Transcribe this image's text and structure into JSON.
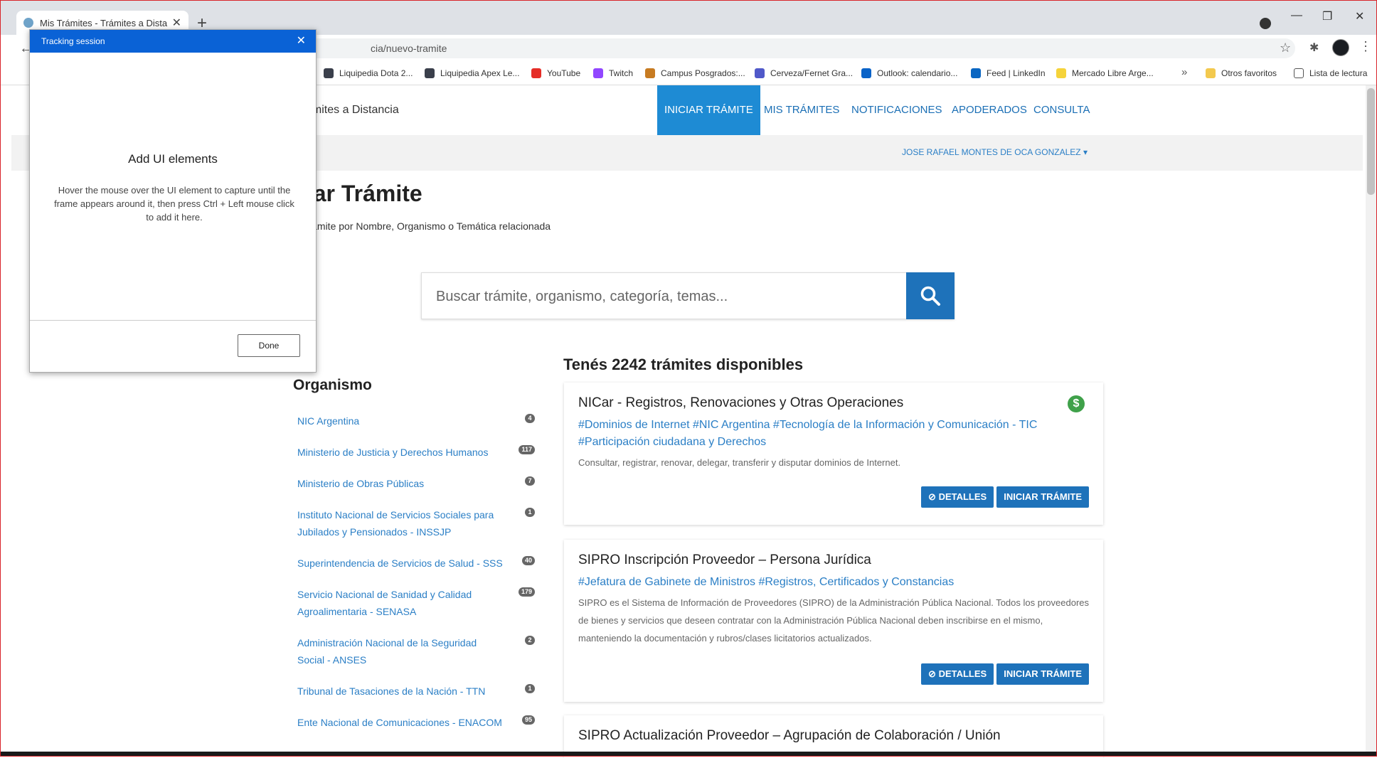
{
  "browser": {
    "tab_title": "Mis Trámites - Trámites a Distancia",
    "url": "cia/nuevo-tramite",
    "bookmarks": [
      {
        "label": "Liquipedia Dota 2...",
        "color": "#3a3f4b"
      },
      {
        "label": "Liquipedia Apex Le...",
        "color": "#3a3f4b"
      },
      {
        "label": "YouTube",
        "color": "#e52d27"
      },
      {
        "label": "Twitch",
        "color": "#9146ff"
      },
      {
        "label": "Campus Posgrados:...",
        "color": "#c77b21"
      },
      {
        "label": "Cerveza/Fernet Gra...",
        "color": "#5059c9"
      },
      {
        "label": "Outlook: calendario...",
        "color": "#0a63c8"
      },
      {
        "label": "Feed | LinkedIn",
        "color": "#0a66c2"
      },
      {
        "label": "Mercado Libre Arge...",
        "color": "#f5d33a"
      }
    ],
    "other_bookmarks": "Otros favoritos",
    "reading_list": "Lista de lectura"
  },
  "site": {
    "brand": "ámites a Distancia",
    "nav": [
      "INICIAR TRÁMITE",
      "MIS TRÁMITES",
      "NOTIFICACIONES",
      "APODERADOS",
      "CONSULTA"
    ],
    "user": "JOSE RAFAEL MONTES DE OCA GONZALEZ"
  },
  "main": {
    "title": "ciar Trámite",
    "subtitle": " tu trámite por Nombre, Organismo o Temática relacionada",
    "search_placeholder": "Buscar trámite, organismo, categoría, temas..."
  },
  "organismo": {
    "title": "Organismo",
    "items": [
      {
        "label": "NIC Argentina",
        "count": "4"
      },
      {
        "label": "Ministerio de Justicia y Derechos Humanos",
        "count": "117"
      },
      {
        "label": "Ministerio de Obras Públicas",
        "count": "7"
      },
      {
        "label": "Instituto Nacional de Servicios Sociales para Jubilados y Pensionados - INSSJP",
        "count": "1"
      },
      {
        "label": "Superintendencia de Servicios de Salud - SSS",
        "count": "40"
      },
      {
        "label": "Servicio Nacional de Sanidad y Calidad Agroalimentaria - SENASA",
        "count": "179"
      },
      {
        "label": "Administración Nacional de la Seguridad Social - ANSES",
        "count": "2"
      },
      {
        "label": "Tribunal de Tasaciones de la Nación - TTN",
        "count": "1"
      },
      {
        "label": "Ente Nacional de Comunicaciones - ENACOM",
        "count": "95"
      }
    ]
  },
  "results": {
    "title": "Tenés 2242 trámites disponibles",
    "details_label": "DETALLES",
    "start_label": "INICIAR TRÁMITE",
    "cards": [
      {
        "title": "NICar - Registros, Renovaciones y Otras Operaciones",
        "tags": "#Dominios de Internet #NIC Argentina #Tecnología de la Información y Comunicación - TIC #Participación ciudadana y Derechos",
        "desc": "Consultar, registrar, renovar, delegar, transferir y disputar dominios de Internet."
      },
      {
        "title": "SIPRO Inscripción Proveedor – Persona Jurídica",
        "tags": "#Jefatura de Gabinete de Ministros #Registros, Certificados y Constancias",
        "desc": "SIPRO es el Sistema de Información de Proveedores (SIPRO) de la Administración Pública Nacional. Todos los proveedores de bienes y servicios que deseen contratar con la Administración Pública Nacional deben inscribirse en el mismo, manteniendo la documentación y rubros/clases licitatorios actualizados."
      },
      {
        "title": "SIPRO Actualización Proveedor – Agrupación de Colaboración / Unión"
      }
    ]
  },
  "dialog": {
    "header": "Tracking session",
    "title": "Add UI elements",
    "text": "Hover the mouse over the UI element to capture until the frame appears around it, then press Ctrl + Left mouse click to add it here.",
    "done": "Done"
  }
}
